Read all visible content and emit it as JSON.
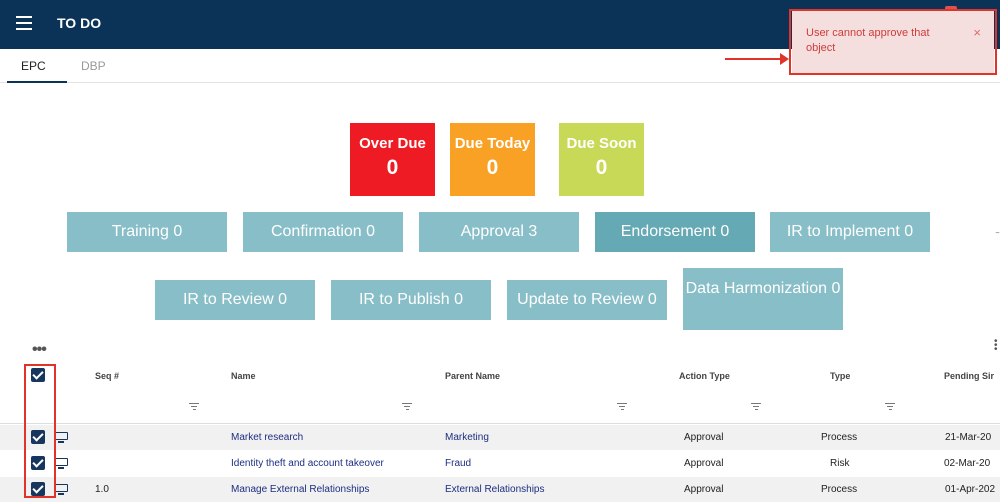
{
  "header": {
    "title": "TO DO"
  },
  "toast": {
    "message": "User cannot approve that object",
    "close": "×"
  },
  "tabs": [
    {
      "label": "EPC"
    },
    {
      "label": "DBP"
    }
  ],
  "status_cards": [
    {
      "label": "Over Due",
      "count": "0",
      "color": "#ee1b24"
    },
    {
      "label": "Due Today",
      "count": "0",
      "color": "#f8a125"
    },
    {
      "label": "Due Soon",
      "count": "0",
      "color": "#c7d956"
    }
  ],
  "categories": [
    {
      "label": "Training 0"
    },
    {
      "label": "Confirmation 0"
    },
    {
      "label": "Approval 3"
    },
    {
      "label": "Endorsement 0"
    },
    {
      "label": "IR to Implement 0"
    },
    {
      "label": "IR to Review 0"
    },
    {
      "label": "IR to Publish 0"
    },
    {
      "label": "Update to Review 0"
    },
    {
      "label": "Data Harmonization 0"
    }
  ],
  "table": {
    "more": "•••",
    "columns": [
      "Seq #",
      "Name",
      "Parent Name",
      "Action Type",
      "Type",
      "Pending Sir"
    ],
    "rows": [
      {
        "seq": "",
        "name": "Market research",
        "parent": "Marketing",
        "action": "Approval",
        "type": "Process",
        "pending": "21-Mar-20"
      },
      {
        "seq": "",
        "name": "Identity theft and account takeover",
        "parent": "Fraud",
        "action": "Approval",
        "type": "Risk",
        "pending": "02-Mar-20"
      },
      {
        "seq": "1.0",
        "name": "Manage External Relationships",
        "parent": "External Relationships",
        "action": "Approval",
        "type": "Process",
        "pending": "01-Apr-202"
      }
    ]
  }
}
